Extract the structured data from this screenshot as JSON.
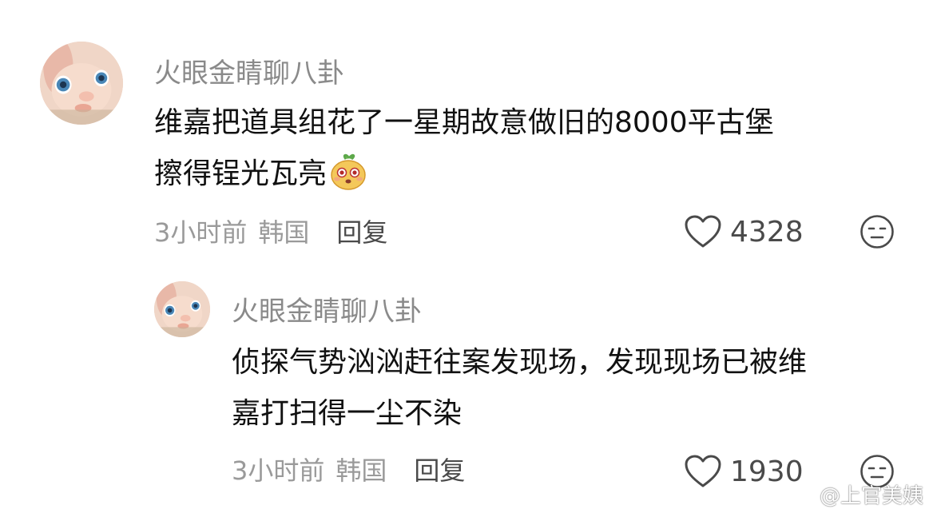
{
  "comments": [
    {
      "username": "火眼金睛聊八卦",
      "text_line1": "维嘉把道具组花了一星期故意做旧的8000平古堡",
      "text_line2": "擦得锃光瓦亮",
      "emoji_icon": "smiling-blob-emoji-icon",
      "time": "3小时前",
      "location": "韩国",
      "reply_label": "回复",
      "likes": "4328"
    },
    {
      "username": "火眼金睛聊八卦",
      "text_line1": "侦探气势汹汹赶往案发现场，发现现场已被维",
      "text_line2": "嘉打扫得一尘不染",
      "time": "3小时前",
      "location": "韩国",
      "reply_label": "回复",
      "likes": "1930"
    }
  ],
  "watermark": {
    "text": "@上官美姨",
    "icon": "weibo-logo-icon"
  },
  "colors": {
    "username": "#8a8a8a",
    "text": "#111111",
    "meta": "#9a9a9a",
    "action": "#4a4a4a",
    "background": "#ffffff"
  }
}
